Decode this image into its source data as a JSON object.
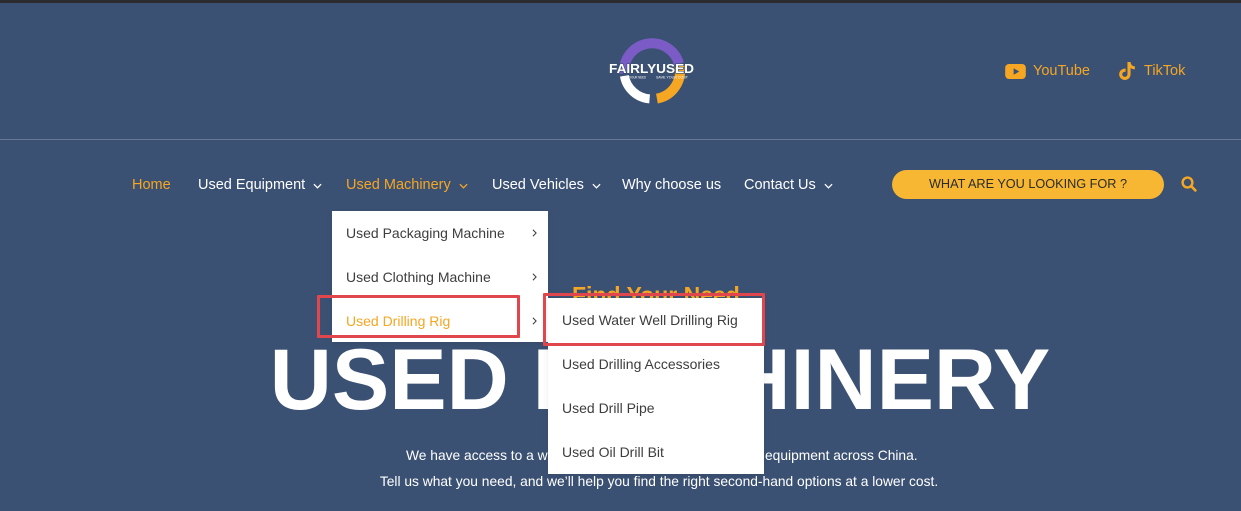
{
  "colors": {
    "background": "#3b5173",
    "top_bar": "#2a2c30",
    "accent": "#f5a623",
    "button": "#f7b733",
    "button_text": "#2c2c2c",
    "menu_text": "#3d3d3d",
    "highlight_box": "#e0474c",
    "logo_purple": "#7b5cc6",
    "text": "#ffffff"
  },
  "header": {
    "logo": {
      "name": "FAIRLYUSED",
      "tagline_left": "FIND YOUR NEED",
      "tagline_right": "SAVE YOUR COST"
    },
    "social": [
      {
        "label": "YouTube",
        "icon": "youtube-icon"
      },
      {
        "label": "TikTok",
        "icon": "tiktok-icon"
      }
    ]
  },
  "nav": {
    "items": [
      {
        "label": "Home",
        "active": true,
        "has_dropdown": false
      },
      {
        "label": "Used Equipment",
        "active": false,
        "has_dropdown": true
      },
      {
        "label": "Used Machinery",
        "active": true,
        "has_dropdown": true
      },
      {
        "label": "Used Vehicles",
        "active": false,
        "has_dropdown": true
      },
      {
        "label": "Why choose us",
        "active": false,
        "has_dropdown": false
      },
      {
        "label": "Contact Us",
        "active": false,
        "has_dropdown": true
      }
    ],
    "cta_label": "WHAT ARE YOU LOOKING FOR ?",
    "search_icon": "search-icon"
  },
  "dropdown": {
    "items": [
      {
        "label": "Used Packaging Machine",
        "has_submenu": true,
        "active": false
      },
      {
        "label": "Used Clothing Machine",
        "has_submenu": true,
        "active": false
      },
      {
        "label": "Used Drilling Rig",
        "has_submenu": true,
        "active": true,
        "highlighted": true
      }
    ]
  },
  "submenu": {
    "items": [
      {
        "label": "Used Water Well Drilling Rig",
        "highlighted": true
      },
      {
        "label": "Used Drilling Accessories"
      },
      {
        "label": "Used Drill Pipe"
      },
      {
        "label": "Used Oil Drill Bit"
      }
    ]
  },
  "hero": {
    "kicker": "Find Your Need",
    "title": "USED MACHINERY",
    "line1_left": "We have access to a wi",
    "line1_right": "equipment across China.",
    "line2": "Tell us what you need, and we’ll help you find the right second-hand options at a lower cost."
  }
}
